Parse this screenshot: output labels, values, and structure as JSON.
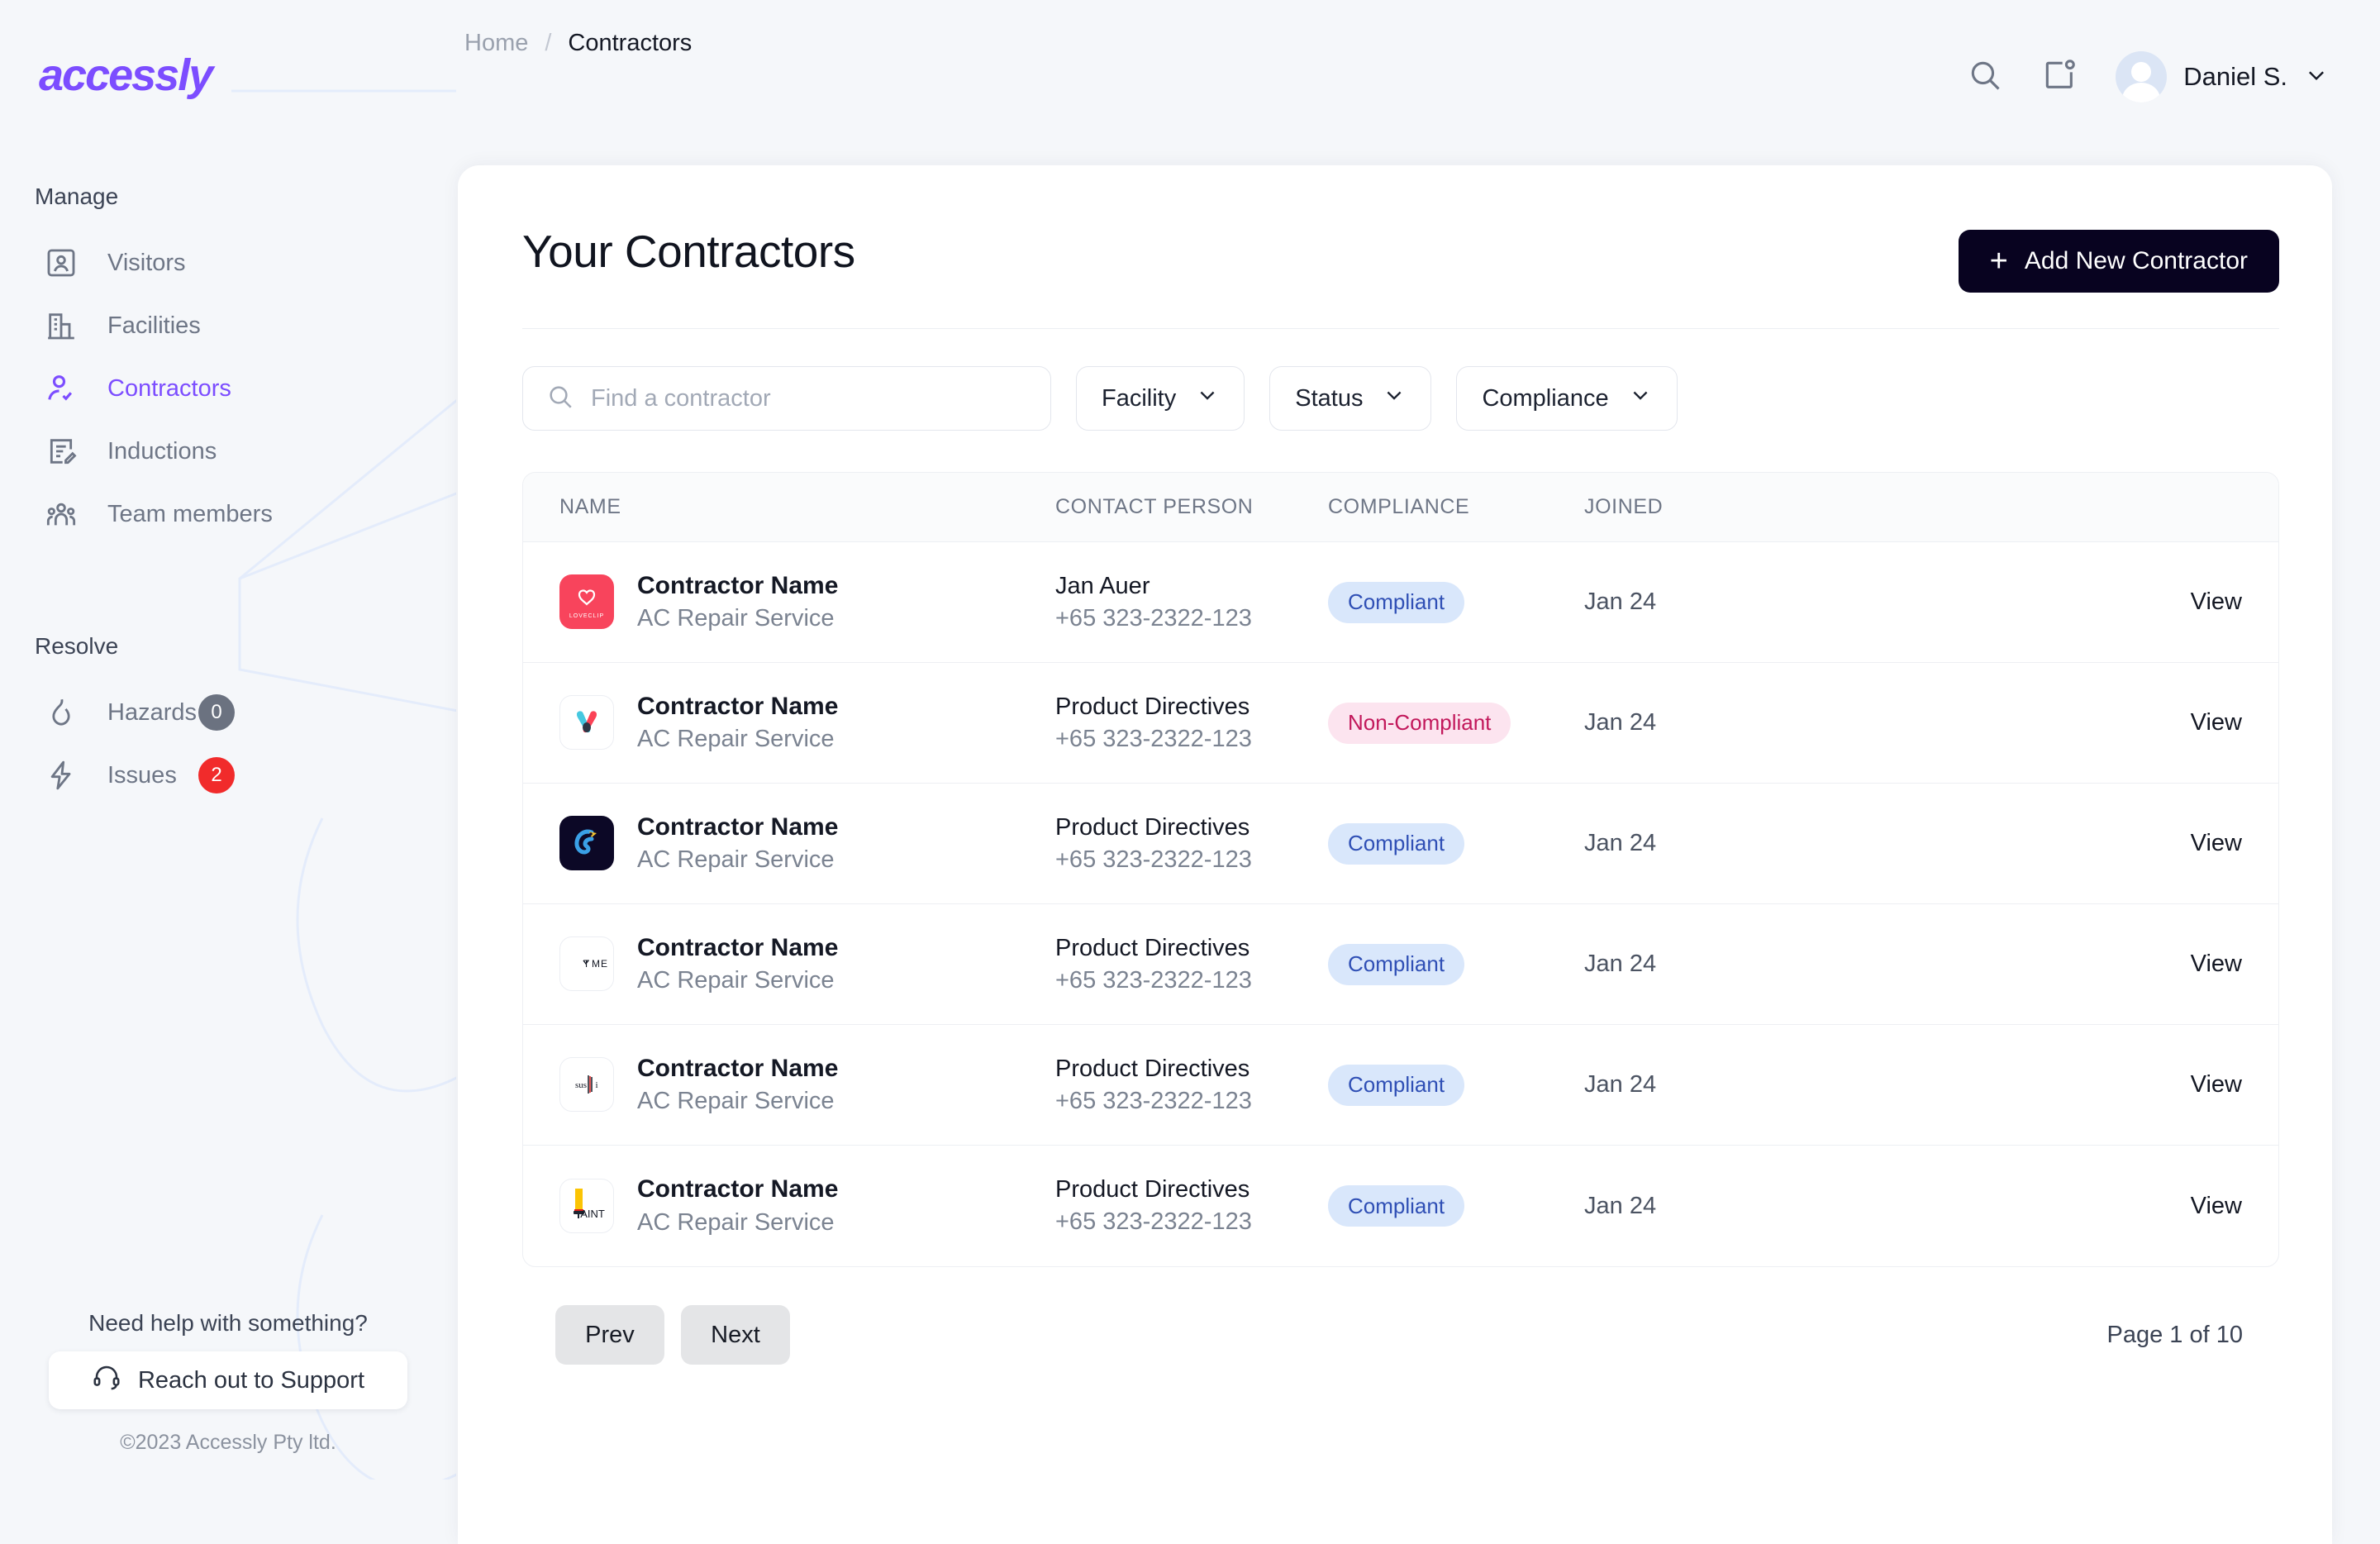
{
  "brand": {
    "logo_text": "accessly"
  },
  "sidebar": {
    "sections": [
      {
        "title": "Manage",
        "items": [
          {
            "label": "Visitors",
            "icon": "id-card-icon",
            "active": false,
            "badge": null
          },
          {
            "label": "Facilities",
            "icon": "building-icon",
            "active": false,
            "badge": null
          },
          {
            "label": "Contractors",
            "icon": "user-check-icon",
            "active": true,
            "badge": null
          },
          {
            "label": "Inductions",
            "icon": "document-edit-icon",
            "active": false,
            "badge": null
          },
          {
            "label": "Team members",
            "icon": "people-group-icon",
            "active": false,
            "badge": null
          }
        ]
      },
      {
        "title": "Resolve",
        "items": [
          {
            "label": "Hazards",
            "icon": "flame-icon",
            "active": false,
            "badge": "0",
            "badge_color": "#6b7280"
          },
          {
            "label": "Issues",
            "icon": "bolt-icon",
            "active": false,
            "badge": "2",
            "badge_color": "#f12b2b"
          }
        ]
      }
    ],
    "support": {
      "question": "Need help with something?",
      "button_label": "Reach out to Support",
      "button_icon": "headset-icon",
      "copyright": "©2023 Accessly Pty ltd."
    }
  },
  "topbar": {
    "breadcrumb": {
      "home": "Home",
      "separator": "/",
      "current": "Contractors"
    },
    "search_icon": "search-icon",
    "notifications_icon": "notification-card-icon",
    "user": {
      "name": "Daniel S.",
      "chevron": "chevron-down-icon"
    }
  },
  "page": {
    "title": "Your Contractors",
    "add_button": {
      "label": "Add New Contractor",
      "icon": "plus-icon",
      "bg": "#080320"
    }
  },
  "filters": {
    "search": {
      "placeholder": "Find a contractor",
      "value": "",
      "icon": "search-icon"
    },
    "dropdowns": [
      {
        "label": "Facility",
        "icon": "chevron-down-icon"
      },
      {
        "label": "Status",
        "icon": "chevron-down-icon"
      },
      {
        "label": "Compliance",
        "icon": "chevron-down-icon"
      }
    ]
  },
  "table": {
    "columns": [
      "NAME",
      "CONTACT PERSON",
      "COMPLIANCE",
      "JOINED"
    ],
    "action_label": "View",
    "rows": [
      {
        "logo": "loveclip-logo",
        "name": "Contractor Name",
        "service": "AC Repair Service",
        "contact_name": "Jan Auer",
        "contact_phone": "+65 323-2322-123",
        "compliance": "Compliant",
        "compliance_state": "ok",
        "joined": "Jan 24",
        "action": "View"
      },
      {
        "logo": "m-mark-logo",
        "name": "Contractor Name",
        "service": "AC Repair Service",
        "contact_name": "Product Directives",
        "contact_phone": "+65 323-2322-123",
        "compliance": "Non-Compliant",
        "compliance_state": "no",
        "joined": "Jan 24",
        "action": "View"
      },
      {
        "logo": "chameleon-logo",
        "name": "Contractor Name",
        "service": "AC Repair Service",
        "contact_name": "Product Directives",
        "contact_phone": "+65 323-2322-123",
        "compliance": "Compliant",
        "compliance_state": "ok",
        "joined": "Jan 24",
        "action": "View"
      },
      {
        "logo": "tyme-logo",
        "name": "Contractor Name",
        "service": "AC Repair Service",
        "contact_name": "Product Directives",
        "contact_phone": "+65 323-2322-123",
        "compliance": "Compliant",
        "compliance_state": "ok",
        "joined": "Jan 24",
        "action": "View"
      },
      {
        "logo": "sushi-logo",
        "name": "Contractor Name",
        "service": "AC Repair Service",
        "contact_name": "Product Directives",
        "contact_phone": "+65 323-2322-123",
        "compliance": "Compliant",
        "compliance_state": "ok",
        "joined": "Jan 24",
        "action": "View"
      },
      {
        "logo": "paint-logo",
        "name": "Contractor Name",
        "service": "AC Repair Service",
        "contact_name": "Product Directives",
        "contact_phone": "+65 323-2322-123",
        "compliance": "Compliant",
        "compliance_state": "ok",
        "joined": "Jan 24",
        "action": "View"
      }
    ]
  },
  "pagination": {
    "prev": "Prev",
    "next": "Next",
    "info": "Page 1 of 10"
  },
  "colors": {
    "brand_purple": "#7c4dff",
    "page_bg": "#f5f7fa",
    "compliant_bg": "#d9e7fb",
    "compliant_text": "#2f4fb5",
    "noncompliant_bg": "#fce4ef",
    "noncompliant_text": "#c2185b",
    "add_button_bg": "#080320"
  }
}
